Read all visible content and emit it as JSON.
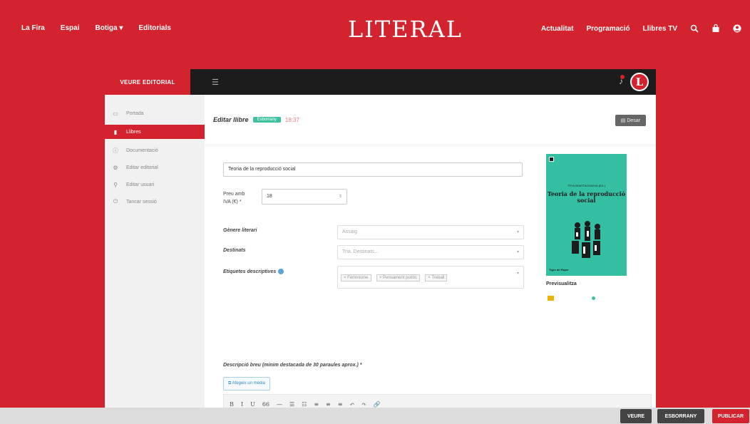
{
  "topnav": {
    "left": [
      "La Fira",
      "Espai",
      "Botiga ▾",
      "Editorials"
    ],
    "logo": "LITERAL",
    "right": [
      "Actualitat",
      "Programació",
      "Llibres TV"
    ]
  },
  "app": {
    "back_label": "VEURE EDITORIAL",
    "menu_toggle": "☰",
    "avatar_letter": "L",
    "sidebar": [
      {
        "icon": "home-icon",
        "label": "Portada"
      },
      {
        "icon": "book-icon",
        "label": "Llibres",
        "active": true
      },
      {
        "icon": "doc-icon",
        "label": "Documentació"
      },
      {
        "icon": "edit-icon",
        "label": "Editar editorial"
      },
      {
        "icon": "user-icon",
        "label": "Editar usuari"
      },
      {
        "icon": "logout-icon",
        "label": "Tancar sessió"
      }
    ],
    "editor": {
      "title": "Editar llibre",
      "status": "Esborrany",
      "time": "18:37",
      "save_label": "Desar"
    },
    "form": {
      "title_value": "Teoria de la reproducció social",
      "price_label": "Preu amb IVA (€) *",
      "price_value": "18",
      "genre_label": "Gènere literari",
      "genre_value": "Assaig",
      "audience_label": "Destinats",
      "audience_placeholder": "Tria. Destinats...",
      "tags_label": "Etiquetes descriptives",
      "tags": [
        "× Feminisme",
        "× Pensament polític",
        "× Treball"
      ],
      "desc_label": "Descripció breu (mínim destacada de 30 paraules aprox.) *",
      "media_button": "Afegeix un mèdia",
      "toolbar": [
        "B",
        "I",
        "U",
        "66",
        "—",
        "☰",
        "☷",
        "≡",
        "≡",
        "≡",
        "↶",
        "↷",
        "🔗"
      ]
    },
    "cover": {
      "author": "TITHI BHATTACHARYA (ED.)",
      "title": "Teoria de la reproducció social",
      "publisher": "Tigre de Paper",
      "thumb_label": "Previsualitza"
    }
  },
  "footer": {
    "view": "VEURE",
    "draft": "ESBORRANY",
    "publish": "PUBLICAR"
  }
}
